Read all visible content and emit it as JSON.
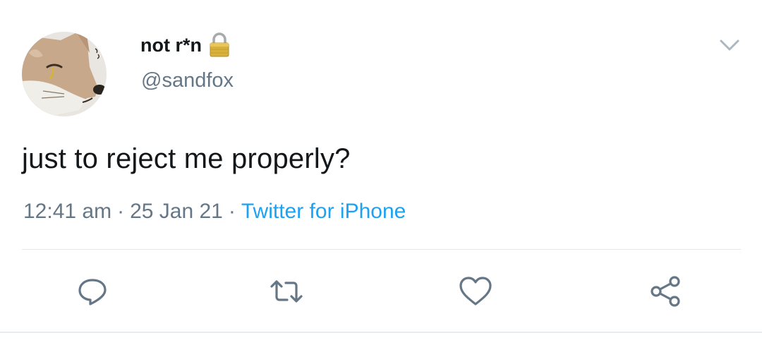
{
  "tweet": {
    "display_name": "not r*n",
    "handle": "@sandfox",
    "text": "just to reject me properly?",
    "time": "12:41 am",
    "date": "25 Jan 21",
    "separator": "·",
    "source": "Twitter for iPhone"
  },
  "icons": {
    "lock": "lock-icon",
    "chevron": "chevron-down-icon",
    "reply": "reply-icon",
    "retweet": "retweet-icon",
    "like": "heart-icon",
    "share": "share-icon"
  },
  "colors": {
    "text_primary": "#14171a",
    "text_secondary": "#657786",
    "link": "#1da1f2",
    "icon": "#657786",
    "divider": "#e1e8ed"
  }
}
